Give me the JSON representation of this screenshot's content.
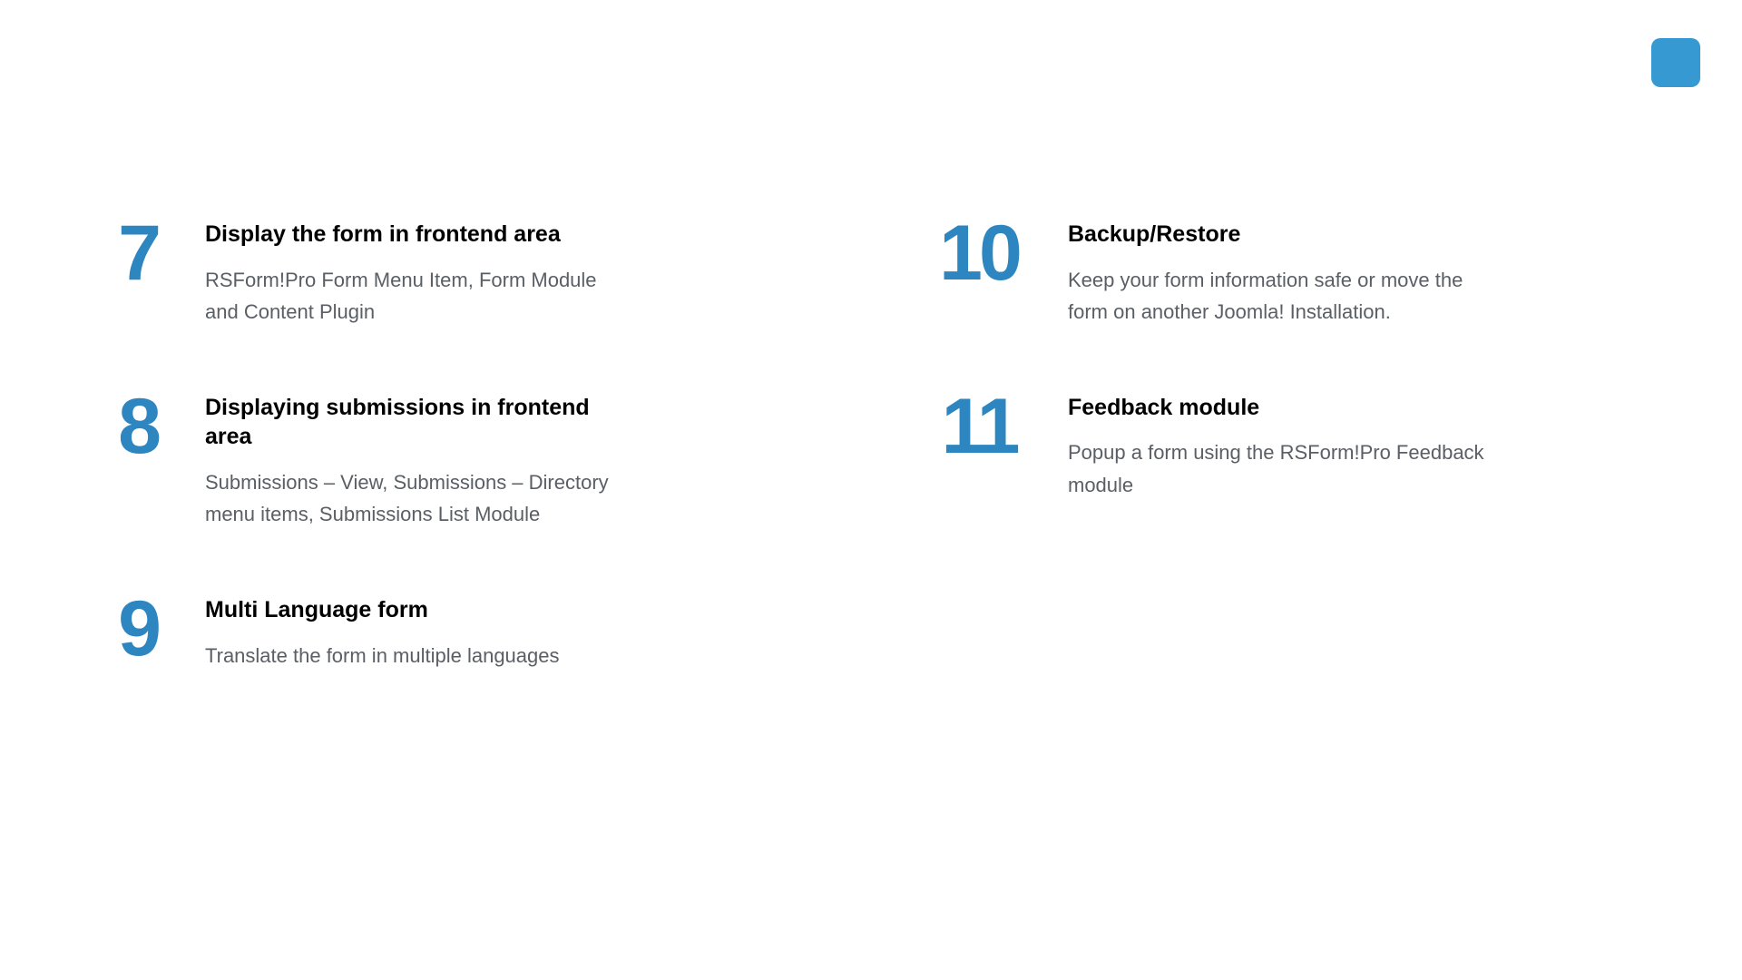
{
  "colors": {
    "accent": "#3799d2",
    "muted": "#5a5f66"
  },
  "left": [
    {
      "num": "7",
      "title": "Display the form in frontend area",
      "desc": "RSForm!Pro Form Menu Item, Form Module and Content Plugin"
    },
    {
      "num": "8",
      "title": "Displaying submissions in frontend area",
      "desc": "Submissions – View, Submissions – Directory menu items, Submissions List Module"
    },
    {
      "num": "9",
      "title": "Multi Language form",
      "desc": "Translate the form in multiple languages"
    }
  ],
  "right": [
    {
      "num": "10",
      "title": "Backup/Restore",
      "desc": "Keep your form information safe or move the form on another Joomla! Installation."
    },
    {
      "num": "11",
      "title": "Feedback module",
      "desc": "Popup a form using the RSForm!Pro Feedback module"
    }
  ]
}
